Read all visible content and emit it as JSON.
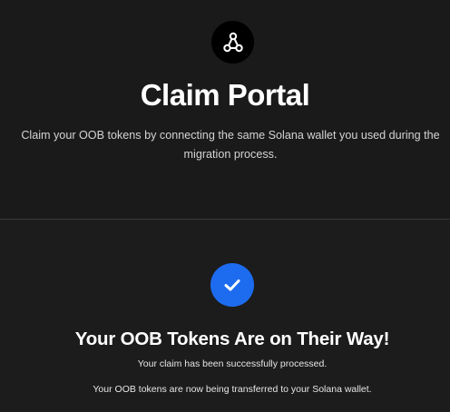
{
  "header": {
    "logo_icon": "link-nodes-icon",
    "title": "Claim Portal",
    "subtitle": "Claim your OOB tokens by connecting the same Solana wallet you used during the migration process."
  },
  "status": {
    "icon": "checkmark-icon",
    "accent_color": "#1d6cf0",
    "title": "Your OOB Tokens Are on Their Way!",
    "message_processed": "Your claim has been successfully processed.",
    "message_transfer": "Your OOB tokens are now being transferred to your Solana wallet."
  }
}
